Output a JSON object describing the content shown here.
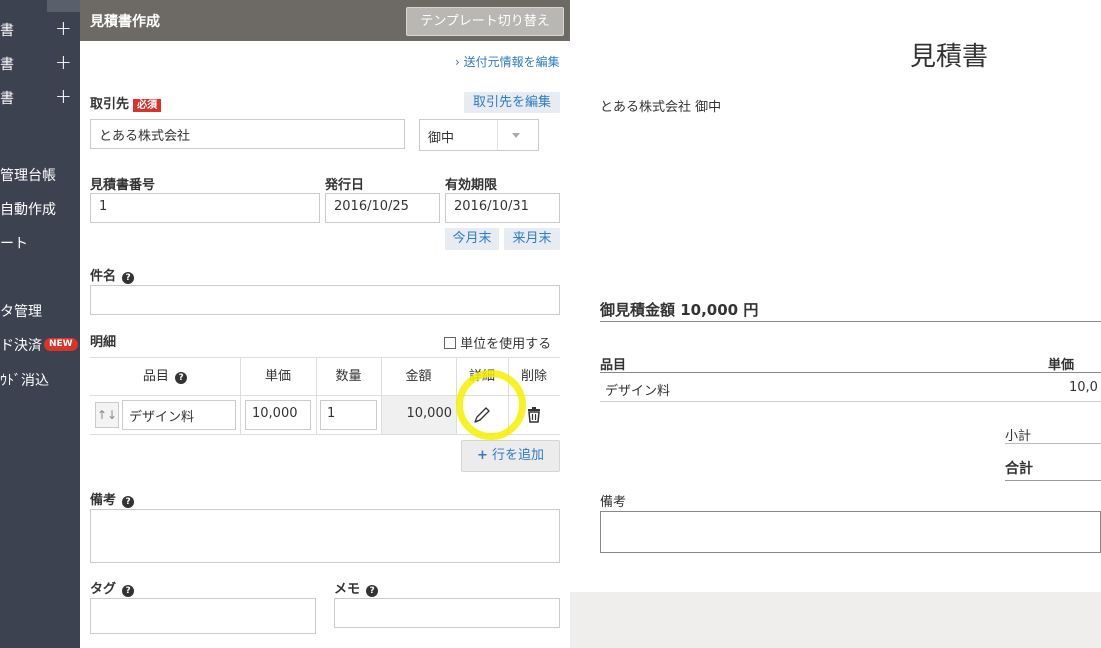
{
  "sidebar": {
    "items": [
      {
        "label": "書",
        "has_plus": true
      },
      {
        "label": "書",
        "has_plus": true
      },
      {
        "label": "書",
        "has_plus": true
      },
      {
        "label": "管理台帳",
        "has_plus": false
      },
      {
        "label": "自動作成",
        "has_plus": false
      },
      {
        "label": "ート",
        "has_plus": false
      },
      {
        "label": "タ管理",
        "has_plus": false
      },
      {
        "label": "ド決済",
        "has_plus": false,
        "badge": "NEW"
      },
      {
        "label": "ｳﾄﾞ消込",
        "has_plus": false
      }
    ],
    "plus_glyph": "+"
  },
  "form": {
    "title": "見積書作成",
    "template_button": "テンプレート切り替え",
    "sender_link": "送付元情報を編集",
    "client": {
      "label": "取引先",
      "required_badge": "必須",
      "edit_link": "取引先を編集",
      "value": "とある株式会社",
      "honorific": "御中"
    },
    "estimate_number": {
      "label": "見積書番号",
      "value": "1"
    },
    "issue_date": {
      "label": "発行日",
      "value": "2016/10/25"
    },
    "expiry": {
      "label": "有効期限",
      "value": "2016/10/31",
      "this_month_end": "今月末",
      "next_month_end": "来月末"
    },
    "subject": {
      "label": "件名",
      "value": ""
    },
    "details": {
      "label": "明細",
      "unit_checkbox_label": "単位を使用する",
      "unit_checked": false,
      "columns": [
        "品目",
        "単価",
        "数量",
        "金額",
        "詳細",
        "削除"
      ],
      "rows": [
        {
          "item": "デザイン料",
          "unit_price": "10,000",
          "quantity": "1",
          "amount": "10,000"
        }
      ],
      "add_row": "行を追加"
    },
    "notes": {
      "label": "備考",
      "value": ""
    },
    "tags": {
      "label": "タグ",
      "value": ""
    },
    "memo": {
      "label": "メモ",
      "value": ""
    }
  },
  "preview": {
    "title": "見積書",
    "client_line": "とある株式会社 御中",
    "total_label": "御見積金額 10,000 円",
    "col_item": "品目",
    "col_unit_price": "単価",
    "row_item": "デザイン料",
    "row_unit_price": "10,0",
    "subtotal_label": "小計",
    "total": "合計",
    "notes_label": "備考"
  },
  "colors": {
    "sidebar_bg": "#3d4250",
    "header_bg": "#6d6a66",
    "link": "#2e7bc4",
    "required": "#d9342b",
    "highlight": "#f5f000"
  }
}
